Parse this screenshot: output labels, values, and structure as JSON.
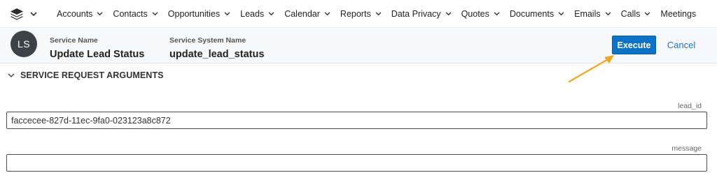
{
  "nav": {
    "items": [
      {
        "label": "Accounts"
      },
      {
        "label": "Contacts"
      },
      {
        "label": "Opportunities"
      },
      {
        "label": "Leads"
      },
      {
        "label": "Calendar"
      },
      {
        "label": "Reports"
      },
      {
        "label": "Data Privacy"
      },
      {
        "label": "Quotes"
      },
      {
        "label": "Documents"
      },
      {
        "label": "Emails"
      },
      {
        "label": "Calls"
      },
      {
        "label": "Meetings"
      }
    ],
    "logo_icon": "stack-layers-icon",
    "logo_chevron_icon": "chevron-down-icon"
  },
  "header": {
    "avatar_initials": "LS",
    "service_name_label": "Service Name",
    "service_name_value": "Update Lead Status",
    "system_name_label": "Service System Name",
    "system_name_value": "update_lead_status",
    "execute_label": "Execute",
    "cancel_label": "Cancel"
  },
  "section": {
    "title": "SERVICE REQUEST ARGUMENTS",
    "toggle_icon": "chevron-down-icon"
  },
  "arguments": [
    {
      "label": "lead_id",
      "value": "faccecee-827d-11ec-9fa0-023123a8c872"
    },
    {
      "label": "message",
      "value": ""
    }
  ],
  "colors": {
    "accent": "#0a73c7",
    "link": "#1a73c9",
    "annotation_arrow": "#f0a81e",
    "avatar_bg": "#3d4148"
  }
}
